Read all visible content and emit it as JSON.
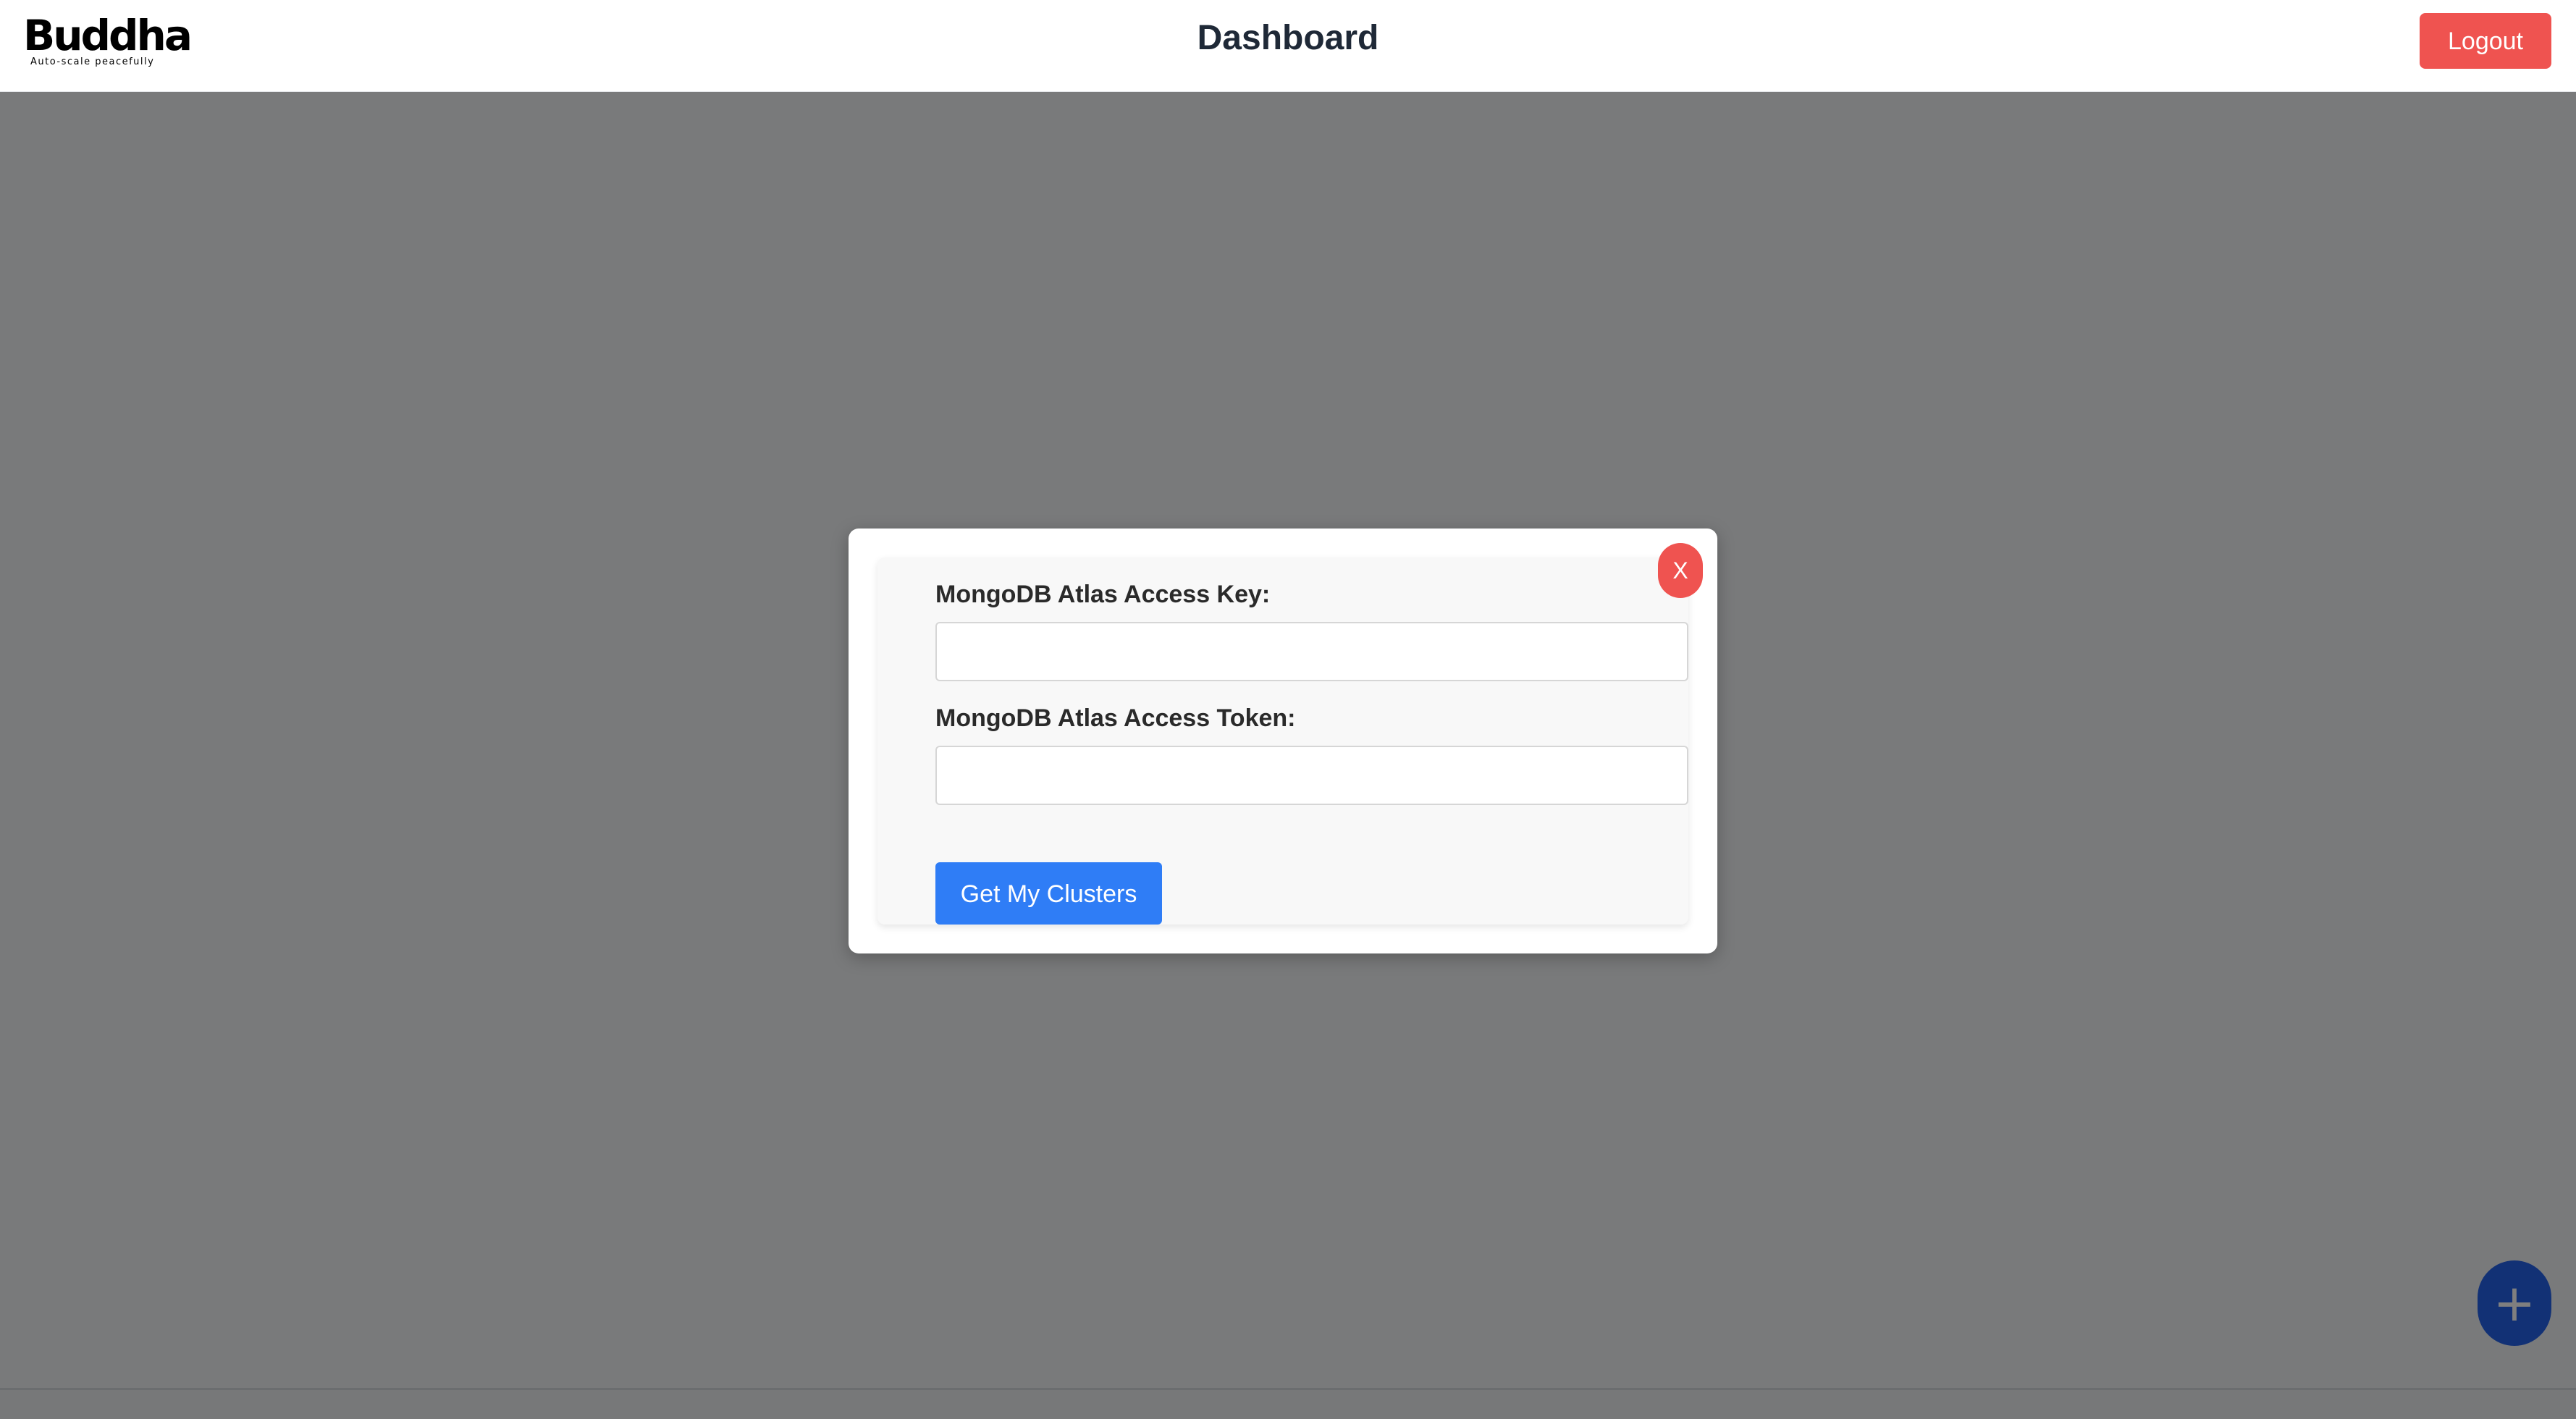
{
  "header": {
    "logo_word": "Buddha",
    "logo_tagline": "Auto-scale peacefully",
    "title": "Dashboard",
    "logout_label": "Logout"
  },
  "fab": {
    "icon": "plus-icon",
    "glyph": "+"
  },
  "modal": {
    "close_label": "X",
    "fields": [
      {
        "label": "MongoDB Atlas Access Key:",
        "value": "",
        "placeholder": ""
      },
      {
        "label": "MongoDB Atlas Access Token:",
        "value": "",
        "placeholder": ""
      }
    ],
    "submit_label": "Get My Clusters"
  },
  "colors": {
    "danger": "#ef5350",
    "primary": "#2f7df6",
    "fab": "#2563eb",
    "overlay": "rgba(0,0,0,0.5)"
  }
}
